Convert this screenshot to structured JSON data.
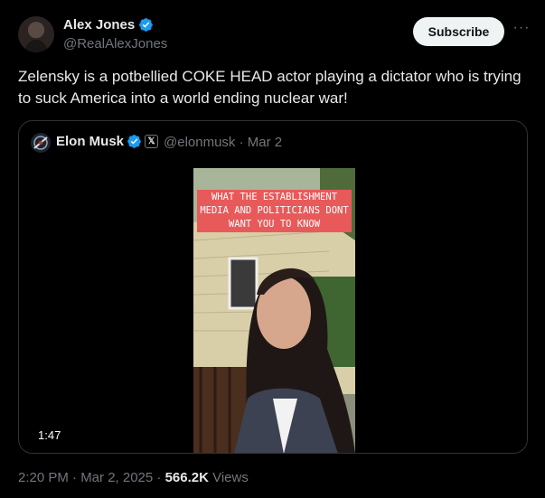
{
  "tweet": {
    "author_name": "Alex Jones",
    "author_handle": "@RealAlexJones",
    "subscribe_label": "Subscribe",
    "more_label": "···",
    "text": "Zelensky is a potbellied COKE HEAD actor playing a dictator who is trying to suck America into a world ending nuclear war!",
    "timestamp": "2:20 PM · Mar 2, 2025 · ",
    "views_count": "566.2K",
    "views_label": " Views"
  },
  "quote": {
    "author_name": "Elon Musk",
    "x_badge": "𝕏",
    "handle_date": "@elonmusk · Mar 2",
    "video_caption": "WHAT THE ESTABLISHMENT MEDIA AND POLITICIANS DONT WANT YOU TO KNOW",
    "video_duration": "1:47"
  },
  "colors": {
    "background": "#000000",
    "verified": "#1d9bf0",
    "caption_bg": "#e85a5a"
  }
}
